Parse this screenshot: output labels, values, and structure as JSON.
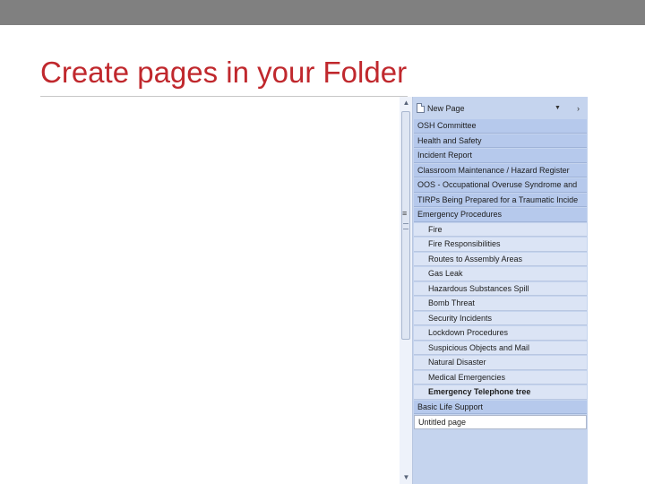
{
  "slide": {
    "title": "Create pages in your Folder"
  },
  "nav_panel": {
    "new_page_label": "New Page",
    "pages": [
      {
        "label": "OSH  Committee",
        "level": 0
      },
      {
        "label": "Health and Safety",
        "level": 0
      },
      {
        "label": "Incident Report",
        "level": 0
      },
      {
        "label": "Classroom Maintenance / Hazard Register",
        "level": 0
      },
      {
        "label": "OOS - Occupational Overuse Syndrome and",
        "level": 0
      },
      {
        "label": "TIRPs  Being Prepared for a Traumatic Incide",
        "level": 0
      },
      {
        "label": "Emergency Procedures",
        "level": 0
      },
      {
        "label": "Fire",
        "level": 1
      },
      {
        "label": "Fire Responsibilities",
        "level": 1
      },
      {
        "label": "Routes to Assembly Areas",
        "level": 1
      },
      {
        "label": "Gas Leak",
        "level": 1
      },
      {
        "label": "Hazardous Substances Spill",
        "level": 1
      },
      {
        "label": "Bomb Threat",
        "level": 1
      },
      {
        "label": "Security Incidents",
        "level": 1
      },
      {
        "label": "Lockdown Procedures",
        "level": 1
      },
      {
        "label": "Suspicious Objects and Mail",
        "level": 1
      },
      {
        "label": "Natural Disaster",
        "level": 1
      },
      {
        "label": "Medical Emergencies",
        "level": 1
      },
      {
        "label": "Emergency Telephone tree",
        "level": 1,
        "bold": true
      },
      {
        "label": "Basic Life Support",
        "level": 0
      },
      {
        "label": "Untitled page",
        "level": 0,
        "selected": true
      }
    ]
  },
  "colors": {
    "title": "#c0282d",
    "top_bar": "#808080",
    "panel": "#c5d4ee"
  }
}
